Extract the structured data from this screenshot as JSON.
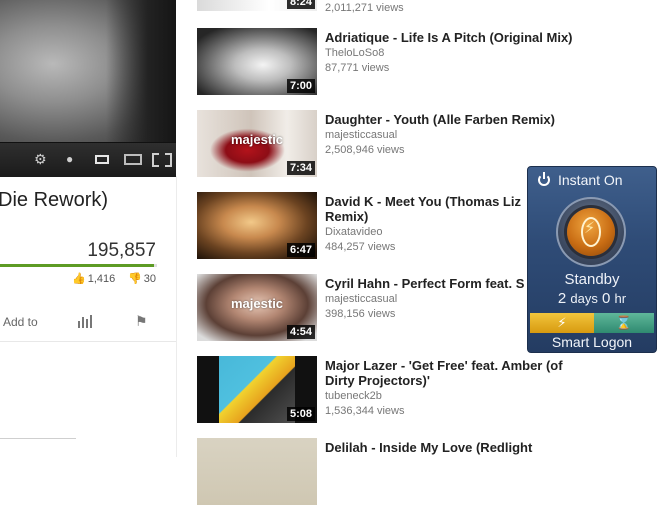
{
  "player": {
    "controls": {
      "settings_icon": "gear-icon",
      "quality_icon": "clock-icon"
    }
  },
  "video": {
    "title": "Die Rework)",
    "view_count": "195,857",
    "likes": "1,416",
    "dislikes": "30",
    "like_ratio": 0.98,
    "actions": {
      "add_to": "Add to"
    }
  },
  "related": [
    {
      "title": "",
      "channel": "",
      "views": "2,011,271 views",
      "duration": "8:24"
    },
    {
      "title": "Adriatique - Life Is A Pitch (Original Mix)",
      "channel": "TheloLoSo8",
      "views": "87,771 views",
      "duration": "7:00"
    },
    {
      "title": "Daughter - Youth (Alle Farben Remix)",
      "channel": "majesticcasual",
      "views": "2,508,946 views",
      "duration": "7:34",
      "watermark": "majestic"
    },
    {
      "title": "David K - Meet You (Thomas Liz Remix)",
      "channel": "Dixatavideo",
      "views": "484,257 views",
      "duration": "6:47"
    },
    {
      "title": "Cyril Hahn - Perfect Form feat. S",
      "channel": "majesticcasual",
      "views": "398,156 views",
      "duration": "4:54",
      "watermark": "majestic"
    },
    {
      "title": "Major Lazer - 'Get Free' feat. Amber (of Dirty Projectors)'",
      "channel": "tubeneck2b",
      "views": "1,536,344 views",
      "duration": "5:08"
    },
    {
      "title": "Delilah - Inside My Love (Redlight",
      "channel": "",
      "views": "",
      "duration": ""
    }
  ],
  "gadget": {
    "title": "Instant On",
    "status": "Standby",
    "time_value_1": "2",
    "time_unit_1": "days",
    "time_value_2": "0",
    "time_unit_2": "hr",
    "footer": "Smart Logon",
    "colors": {
      "panel": "#2f4c77",
      "left_bar": "#e2a81c",
      "right_bar": "#3f9c80"
    }
  }
}
